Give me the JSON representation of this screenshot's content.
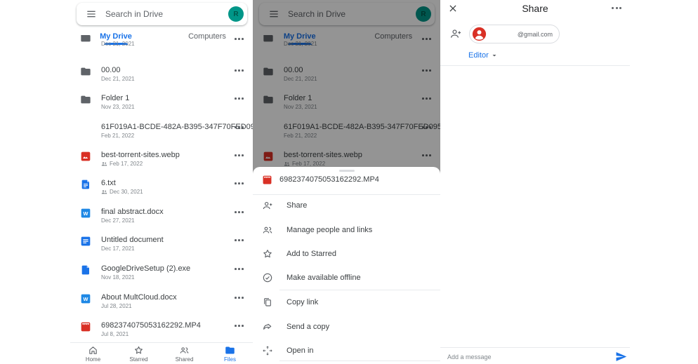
{
  "colors": {
    "accent_blue": "#1a73e8",
    "file_red": "#d93025",
    "avatar_teal": "#009688",
    "icon_grey": "#5f6368",
    "text_primary": "#3c4043",
    "text_secondary": "#80868b",
    "divider": "#e8eaed",
    "scrim": "rgba(0,0,0,0.42)"
  },
  "drive": {
    "search_placeholder": "Search in Drive",
    "avatar_letter": "R",
    "tabs": [
      {
        "label": "My Drive",
        "active": true
      },
      {
        "label": "Computers",
        "active": false
      }
    ],
    "partial_item": {
      "date": "Dec 21, 2021",
      "icon": "folder-icon"
    },
    "items": [
      {
        "name": "00.00",
        "date": "Dec 21, 2021",
        "icon": "folder-icon",
        "shared": false
      },
      {
        "name": "Folder 1",
        "date": "Nov 23, 2021",
        "icon": "folder-icon",
        "shared": false
      },
      {
        "name": "61F019A1-BCDE-482A-B395-347F70FED095....",
        "date": "Feb 21, 2022",
        "icon": "image-thumbnail",
        "shared": false
      },
      {
        "name": "best-torrent-sites.webp",
        "date": "Feb 17, 2022",
        "icon": "image-file-icon",
        "shared": true
      },
      {
        "name": "6.txt",
        "date": "Dec 30, 2021",
        "icon": "text-file-icon",
        "shared": true
      },
      {
        "name": "final abstract.docx",
        "date": "Dec 27, 2021",
        "icon": "word-file-icon",
        "shared": false
      },
      {
        "name": "Untitled document",
        "date": "Dec 17, 2021",
        "icon": "gdoc-file-icon",
        "shared": false
      },
      {
        "name": "GoogleDriveSetup (2).exe",
        "date": "Nov 18, 2021",
        "icon": "generic-file-icon",
        "shared": false
      },
      {
        "name": "About MultCloud.docx",
        "date": "Jul 28, 2021",
        "icon": "word-file-icon",
        "shared": false
      },
      {
        "name": "6982374075053162292.MP4",
        "date": "Jul 8, 2021",
        "icon": "video-file-icon",
        "shared": false
      }
    ],
    "nav": [
      {
        "label": "Home",
        "icon": "home-icon",
        "active": false
      },
      {
        "label": "Starred",
        "icon": "star-icon",
        "active": false
      },
      {
        "label": "Shared",
        "icon": "people-icon",
        "active": false
      },
      {
        "label": "Files",
        "icon": "folder-icon",
        "active": true
      }
    ]
  },
  "sheet": {
    "file": {
      "name": "6982374075053162292.MP4",
      "icon": "video-file-icon"
    },
    "actions": [
      {
        "label": "Share",
        "icon": "person-add-icon"
      },
      {
        "label": "Manage people and links",
        "icon": "people-icon"
      },
      {
        "label": "Add to Starred",
        "icon": "star-icon"
      },
      {
        "label": "Make available offline",
        "icon": "offline-check-circle-icon"
      },
      {
        "label": "Copy link",
        "icon": "copy-icon"
      },
      {
        "label": "Send a copy",
        "icon": "forward-arrow-icon"
      },
      {
        "label": "Open in",
        "icon": "open-with-icon"
      }
    ]
  },
  "share": {
    "title": "Share",
    "recipient_placeholder": "@gmail.com",
    "role": "Editor",
    "message_placeholder": "Add a message"
  }
}
